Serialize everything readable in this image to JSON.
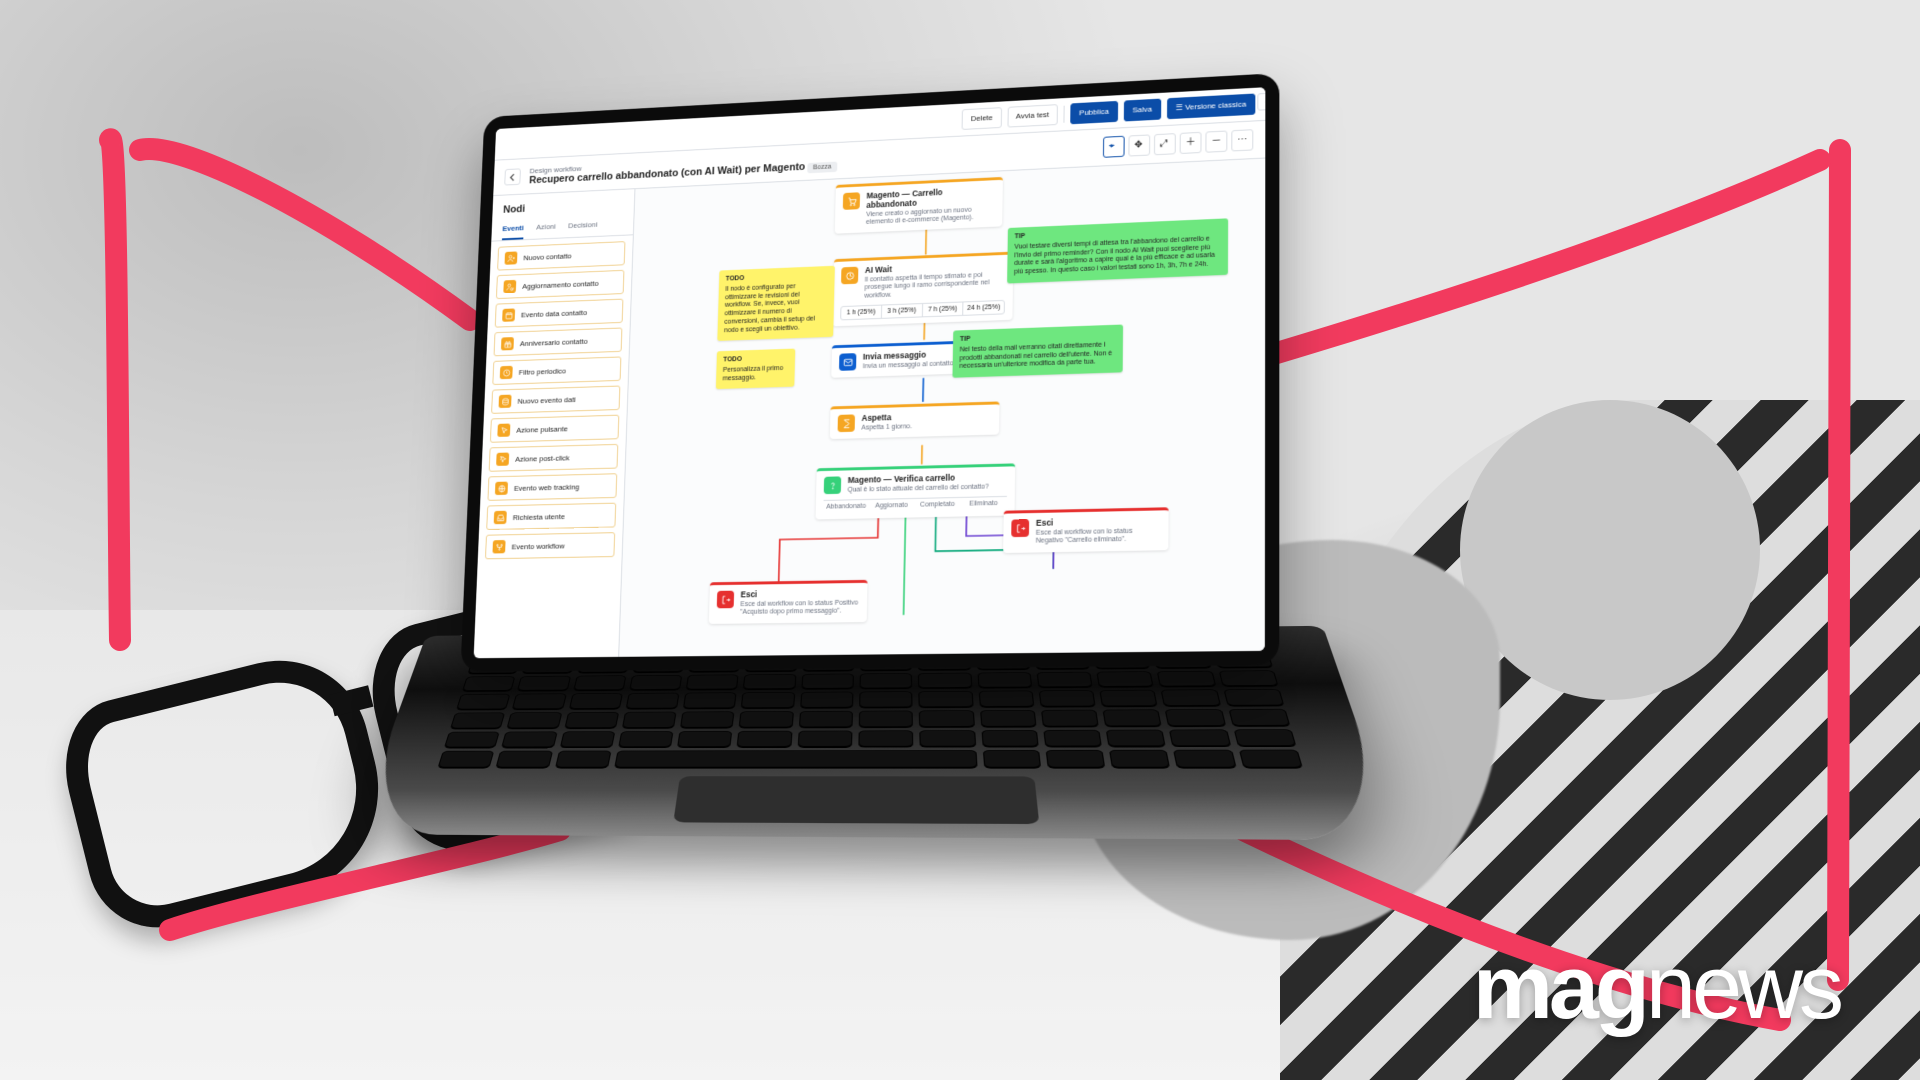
{
  "brand": "magnews",
  "header": {
    "delete": "Delete",
    "runtest": "Avvia test",
    "publish": "Pubblica",
    "save": "Salva",
    "classic": "Versione classica"
  },
  "page": {
    "breadcrumb": "Design workflow",
    "title": "Recupero carrello abbandonato (con AI Wait) per Magento",
    "status_chip": "Bozza"
  },
  "sidebar": {
    "heading": "Nodi",
    "tabs": [
      "Eventi",
      "Azioni",
      "Decisioni"
    ],
    "active_tab": 0,
    "items": [
      {
        "label": "Nuovo contatto",
        "icon": "user-plus",
        "color": "orangebg"
      },
      {
        "label": "Aggiornamento contatto",
        "icon": "user-refresh",
        "color": "orangebg"
      },
      {
        "label": "Evento data contatto",
        "icon": "calendar",
        "color": "orangebg"
      },
      {
        "label": "Anniversario contatto",
        "icon": "gift",
        "color": "orangebg"
      },
      {
        "label": "Filtro periodico",
        "icon": "clock",
        "color": "orangebg"
      },
      {
        "label": "Nuovo evento dati",
        "icon": "database",
        "color": "orangebg"
      },
      {
        "label": "Azione pulsante",
        "icon": "pointer",
        "color": "orangebg"
      },
      {
        "label": "Azione post-click",
        "icon": "cursor-click",
        "color": "orangebg"
      },
      {
        "label": "Evento web tracking",
        "icon": "globe",
        "color": "orangebg"
      },
      {
        "label": "Richiesta utente",
        "icon": "inbox",
        "color": "orangebg"
      },
      {
        "label": "Evento workflow",
        "icon": "flow",
        "color": "orangebg"
      }
    ]
  },
  "nodes": {
    "magento_trigger": {
      "title": "Magento — Carrello abbandonato",
      "sub": "Viene creato o aggiornato un nuovo elemento di e-commerce (Magento)."
    },
    "ai_wait": {
      "title": "AI Wait",
      "sub": "Il contatto aspetta il tempo stimato e poi prosegue lungo il ramo corrispondente nel workflow.",
      "options": [
        "1 h (25%)",
        "3 h (25%)",
        "7 h (25%)",
        "24 h (25%)"
      ]
    },
    "send_msg": {
      "title": "Invia messaggio",
      "sub": "Invia un messaggio al contatto."
    },
    "wait": {
      "title": "Aspetta",
      "sub": "Aspetta 1 giorno."
    },
    "verify": {
      "title": "Magento — Verifica carrello",
      "sub": "Qual è lo stato attuale del carrello del contatto?",
      "branches": [
        "Abbandonato",
        "Aggiornato",
        "Completato",
        "Eliminato"
      ]
    },
    "exit_left": {
      "title": "Esci",
      "sub": "Esce dal workflow con lo status Positivo \"Acquisto dopo primo messaggio\"."
    },
    "exit_right": {
      "title": "Esci",
      "sub": "Esce dal workflow con lo status Negativo \"Carrello eliminato\"."
    }
  },
  "stickies": {
    "todo1": {
      "title": "TODO",
      "body": "Il nodo è configurato per ottimizzare le revisioni del workflow. Se, invece, vuoi ottimizzare il numero di conversioni, cambia il setup del nodo e scegli un obiettivo."
    },
    "todo2": {
      "title": "TODO",
      "body": "Personalizza il primo messaggio."
    },
    "tip1": {
      "title": "TIP",
      "body": "Vuoi testare diversi tempi di attesa tra l'abbandono del carrello e l'invio del primo reminder? Con il nodo AI Wait puoi scegliere più durate e sarà l'algoritmo a capire qual è la più efficace e ad usarla più spesso. In questo caso i valori testati sono 1h, 3h, 7h e 24h."
    },
    "tip2": {
      "title": "TIP",
      "body": "Nel testo della mail verranno citati direttamente i prodotti abbandonati nel carrello dell'utente. Non è necessaria un'ulteriore modifica da parte tua."
    }
  }
}
